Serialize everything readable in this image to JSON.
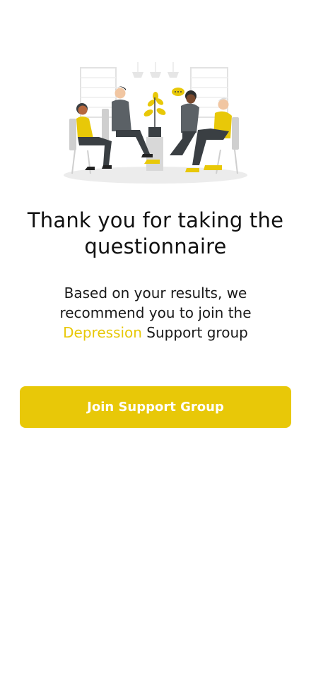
{
  "illustration": {
    "icon": "support-group-illustration",
    "accent_color": "#E8C808"
  },
  "title": "Thank you for taking the questionnaire",
  "message": {
    "before": "Based on your results, we recommend you to join the ",
    "group_name": "Depression",
    "after": " Support group"
  },
  "join_button": {
    "label": "Join Support Group",
    "color": "#E8C808"
  }
}
